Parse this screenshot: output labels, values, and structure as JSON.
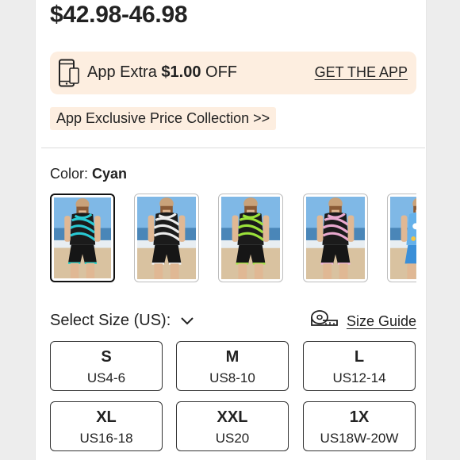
{
  "product": {
    "price_range": "$42.98-46.98"
  },
  "app_banner": {
    "prefix": "App Extra ",
    "amount": "$1.00",
    "suffix": " OFF",
    "link_label": "GET THE APP",
    "icon": "smartphone-icon"
  },
  "collection": {
    "label": "App Exclusive Price Collection >>"
  },
  "color": {
    "label_prefix": "Color: ",
    "selected": "Cyan",
    "swatches": [
      {
        "name": "cyan",
        "stripe": "#29c9d3",
        "trim": "#35d3c8"
      },
      {
        "name": "white",
        "stripe": "#ececec",
        "trim": "#f5f5f5"
      },
      {
        "name": "green",
        "stripe": "#9be23a",
        "trim": "#a8e84a"
      },
      {
        "name": "pink",
        "stripe": "#e9a9cf",
        "trim": "#f1b8da"
      },
      {
        "name": "blue-floral",
        "stripe": "#4aa3e6",
        "trim": "#3a8fd8"
      }
    ]
  },
  "size": {
    "header": "Select Size (US):",
    "guide_label": "Size Guide",
    "guide_icon": "measuring-tape-icon",
    "options": [
      {
        "size": "S",
        "us": "US4-6"
      },
      {
        "size": "M",
        "us": "US8-10"
      },
      {
        "size": "L",
        "us": "US12-14"
      },
      {
        "size": "XL",
        "us": "US16-18"
      },
      {
        "size": "XXL",
        "us": "US20"
      },
      {
        "size": "1X",
        "us": "US18W-20W"
      }
    ]
  }
}
